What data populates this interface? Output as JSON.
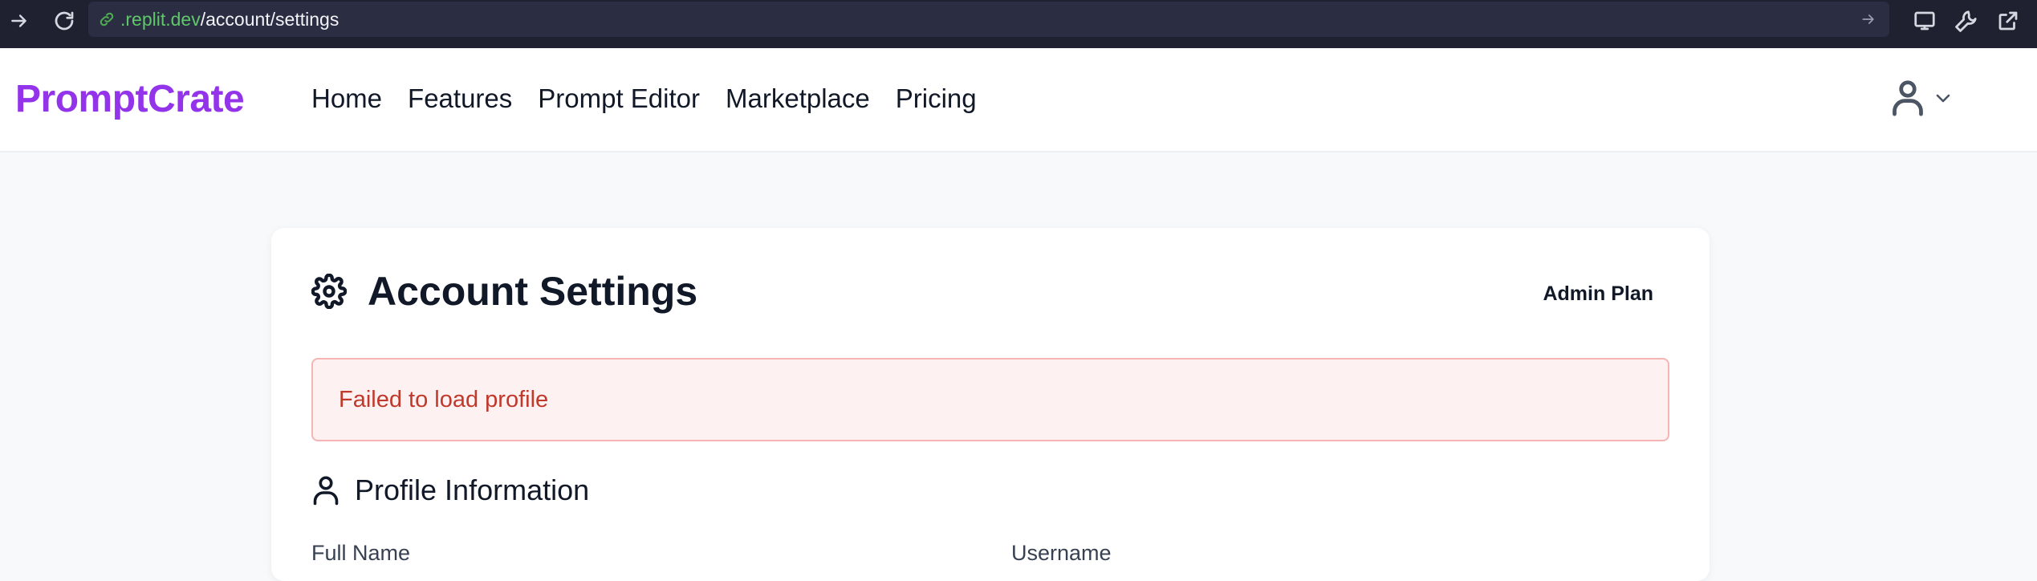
{
  "browser": {
    "url_domain": ".replit.dev",
    "url_path": "/account/settings",
    "icons": [
      "forward-arrow-icon",
      "reload-icon",
      "link-icon",
      "go-arrow-icon",
      "device-icon",
      "wrench-icon",
      "external-link-icon"
    ]
  },
  "site": {
    "brand": "PromptCrate",
    "brand_color": "#9333ea",
    "nav": [
      {
        "label": "Home"
      },
      {
        "label": "Features"
      },
      {
        "label": "Prompt Editor"
      },
      {
        "label": "Marketplace"
      },
      {
        "label": "Pricing"
      }
    ],
    "user_menu_icons": [
      "user-icon",
      "chevron-down-icon"
    ]
  },
  "settings": {
    "title": "Account Settings",
    "plan": "Admin Plan",
    "error": "Failed to load profile",
    "error_color": "#c0392b",
    "profile_section_title": "Profile Information",
    "fields": {
      "full_name_label": "Full Name",
      "username_label": "Username"
    }
  }
}
